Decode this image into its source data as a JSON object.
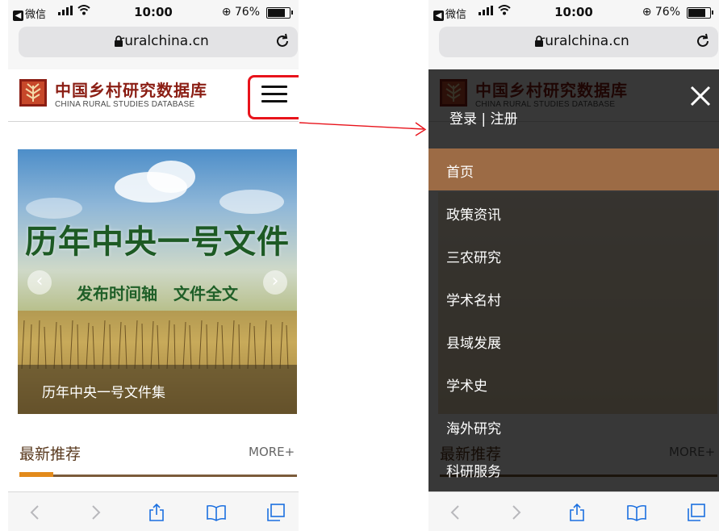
{
  "status_bar": {
    "back_app": "微信",
    "time": "10:00",
    "battery": "76%",
    "battery_level": 0.76
  },
  "browser": {
    "url": "ruralchina.cn"
  },
  "site": {
    "name_cn": "中国乡村研究数据库",
    "name_en": "CHINA RURAL STUDIES DATABASE"
  },
  "banner": {
    "title": "历年中央一号文件",
    "subtitle": "发布时间轴　文件全文",
    "caption": "历年中央一号文件集"
  },
  "section": {
    "title": "最新推荐",
    "more": "MORE+"
  },
  "menu": {
    "login": "登录 | 注册",
    "items": [
      {
        "label": "首页",
        "active": true
      },
      {
        "label": "政策资讯",
        "active": false
      },
      {
        "label": "三农研究",
        "active": false
      },
      {
        "label": "学术名村",
        "active": false
      },
      {
        "label": "县域发展",
        "active": false
      },
      {
        "label": "学术史",
        "active": false
      },
      {
        "label": "海外研究",
        "active": false
      },
      {
        "label": "科研服务",
        "active": false
      }
    ]
  },
  "colors": {
    "brand": "#8b1e14",
    "menu_active": "#9c6b45",
    "highlight": "#e8131b",
    "accent": "#e28a1b"
  }
}
